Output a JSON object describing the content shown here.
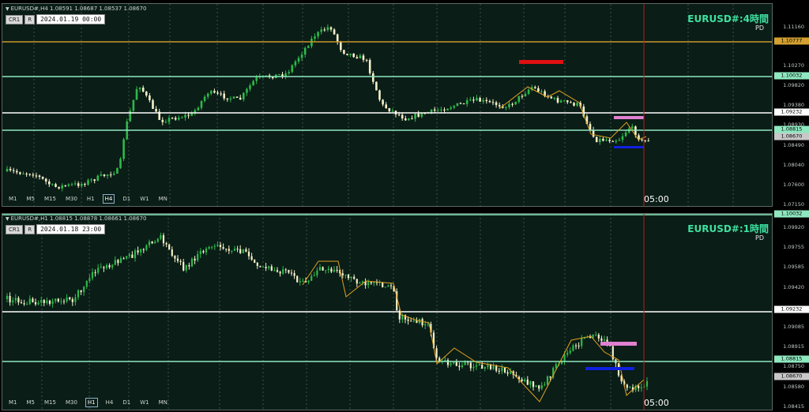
{
  "top": {
    "header": "EURUSD#,H4  1.08591 1.08687 1.08537 1.08670",
    "cr_label": "CR1",
    "r_label": "R",
    "datetime": "2024.01.19 00:00",
    "title": "EURUSD#:4時間",
    "subtitle": "PD",
    "timeframes": [
      "M1",
      "M5",
      "M15",
      "M30",
      "H1",
      "H4",
      "D1",
      "W1",
      "MN"
    ],
    "active_tf": "H4",
    "time_label": "05:00",
    "ticks": [
      "1.11160",
      "1.10777",
      "1.10270",
      "1.09820",
      "1.09380",
      "1.08930",
      "1.08490",
      "1.08040",
      "1.07600",
      "1.07150"
    ],
    "price_tags": [
      "1.10777",
      "1.10032",
      "1.09232",
      "1.08815",
      "1.08670"
    ]
  },
  "bottom": {
    "header": "EURUSD#,H1  1.08815 1.08878 1.08661 1.08670",
    "cr_label": "CR1",
    "r_label": "R",
    "datetime": "2024.01.18 23:00",
    "title": "EURUSD#:1時間",
    "subtitle": "PD",
    "timeframes": [
      "M1",
      "M5",
      "M15",
      "M30",
      "H1",
      "H4",
      "D1",
      "W1",
      "MN"
    ],
    "active_tf": "H1",
    "time_label": "05:00",
    "ticks": [
      "1.10032",
      "1.09920",
      "1.09755",
      "1.09585",
      "1.09420",
      "1.09232",
      "1.09085",
      "1.08915",
      "1.08750",
      "1.08670",
      "1.08580",
      "1.08415"
    ],
    "price_tags": [
      "1.10032",
      "1.09232",
      "1.08815",
      "1.08670"
    ]
  },
  "colors": {
    "background": "#0a1d17",
    "bull": "#2fb84a",
    "bear": "#f5f0c8",
    "level_green": "#8fe8c0",
    "level_white": "#ffffff",
    "level_orange": "#c9962a",
    "zigzag": "#e0a020",
    "red_box": "#e01010",
    "pink_box": "#e080d0",
    "blue_box": "#1020e0",
    "title": "#3fe0a0"
  }
}
